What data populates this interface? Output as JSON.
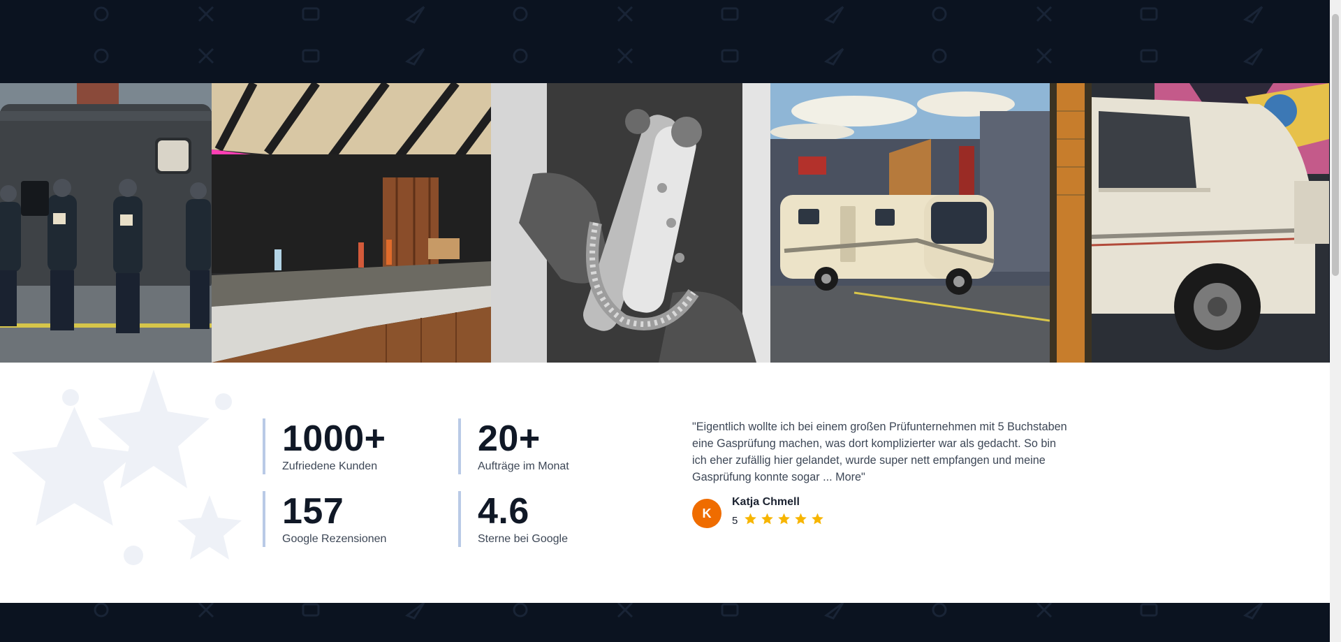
{
  "gallery": {
    "images": [
      {
        "alt": "Team in branded hoodies in front of a dark camper van"
      },
      {
        "alt": "Camper interior build with wooden panels and LED strip"
      },
      {
        "alt": "Black and white photo of hands holding a vehicle part"
      },
      {
        "alt": "Large white motorhome parked in front of the workshop"
      },
      {
        "alt": "White vintage van in a workshop with graffiti wall"
      }
    ]
  },
  "stats": [
    {
      "value": "1000+",
      "label": "Zufriedene Kunden"
    },
    {
      "value": "20+",
      "label": "Aufträge im Monat"
    },
    {
      "value": "157",
      "label": "Google Rezensionen"
    },
    {
      "value": "4.6",
      "label": "Sterne bei Google"
    }
  ],
  "review": {
    "quote": "\"Eigentlich wollte ich bei einem großen Prüfunternehmen mit 5 Buchstaben eine Gasprüfung machen, was dort komplizierter war als gedacht. So bin ich eher zufällig hier gelandet, wurde super nett empfangen und meine Gasprüfung konnte sogar ...",
    "more_label": "More\"",
    "author": "Katja Chmell",
    "avatar_initial": "K",
    "score": "5",
    "stars": 5
  },
  "colors": {
    "dark_bg": "#0b1320",
    "accent_border": "#b9cae6",
    "star": "#f7b500",
    "avatar": "#ef6c00"
  }
}
